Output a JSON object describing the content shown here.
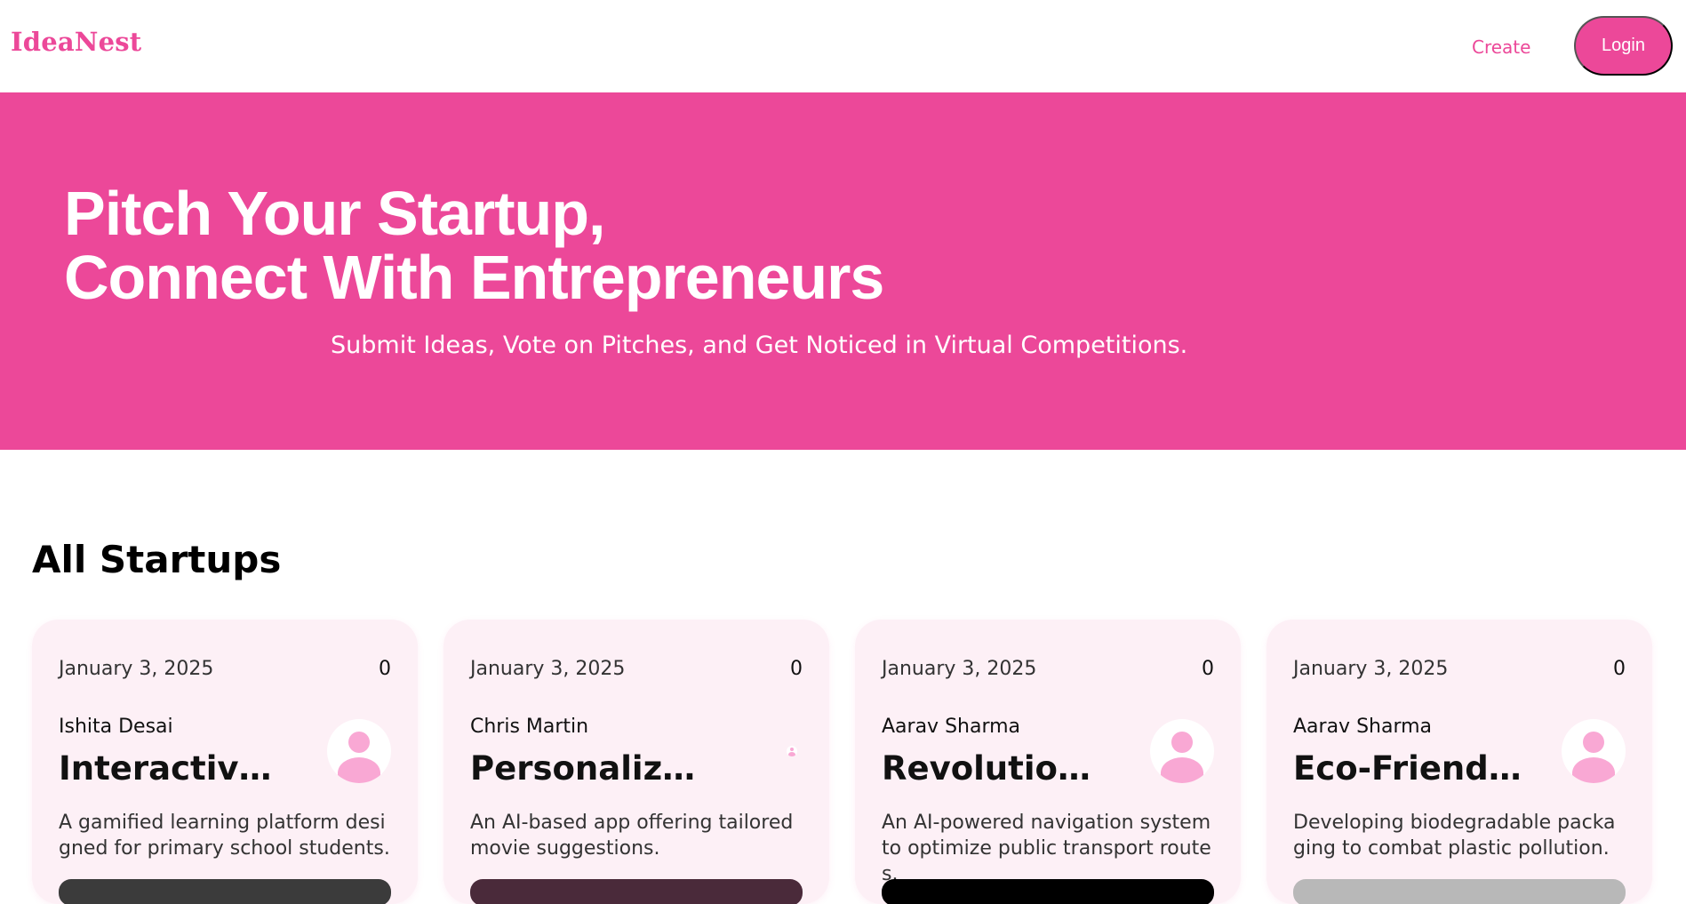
{
  "navbar": {
    "logo": "IdeaNest",
    "create_label": "Create",
    "login_label": "Login"
  },
  "hero": {
    "title_line1": "Pitch Your Startup,",
    "title_line2": "Connect With Entrepreneurs",
    "subtitle": "Submit Ideas, Vote on Pitches, and Get Noticed in Virtual Competitions."
  },
  "section": {
    "title": "All Startups"
  },
  "startups": [
    {
      "date": "January 3, 2025",
      "votes": "0",
      "author": "Ishita Desai",
      "title": "Interactive...",
      "description": "A gamified learning platform designed for primary school students.",
      "avatar_icon": "user-avatar-icon",
      "image_color": "#3b3b3b"
    },
    {
      "date": "January 3, 2025",
      "votes": "0",
      "author": "Chris Martin",
      "title": "Personalized...",
      "description": "An AI-based app offering tailored movie suggestions.",
      "avatar_icon": "user-avatar-icon",
      "image_color": "#4a2a3a"
    },
    {
      "date": "January 3, 2025",
      "votes": "0",
      "author": "Aarav Sharma",
      "title": "Revolutionizi...",
      "description": "An AI-powered navigation system to optimize public transport routes.",
      "avatar_icon": "user-avatar-icon",
      "image_color": "#000000"
    },
    {
      "date": "January 3, 2025",
      "votes": "0",
      "author": "Aarav Sharma",
      "title": "Eco-Friendly...",
      "description": "Developing biodegradable packaging to combat plastic pollution.",
      "avatar_icon": "user-avatar-icon",
      "image_color": "#b8b8b8"
    }
  ],
  "colors": {
    "brand": "#ec4899",
    "card_bg": "#fdf0f6",
    "avatar": "#f9a8d4"
  }
}
